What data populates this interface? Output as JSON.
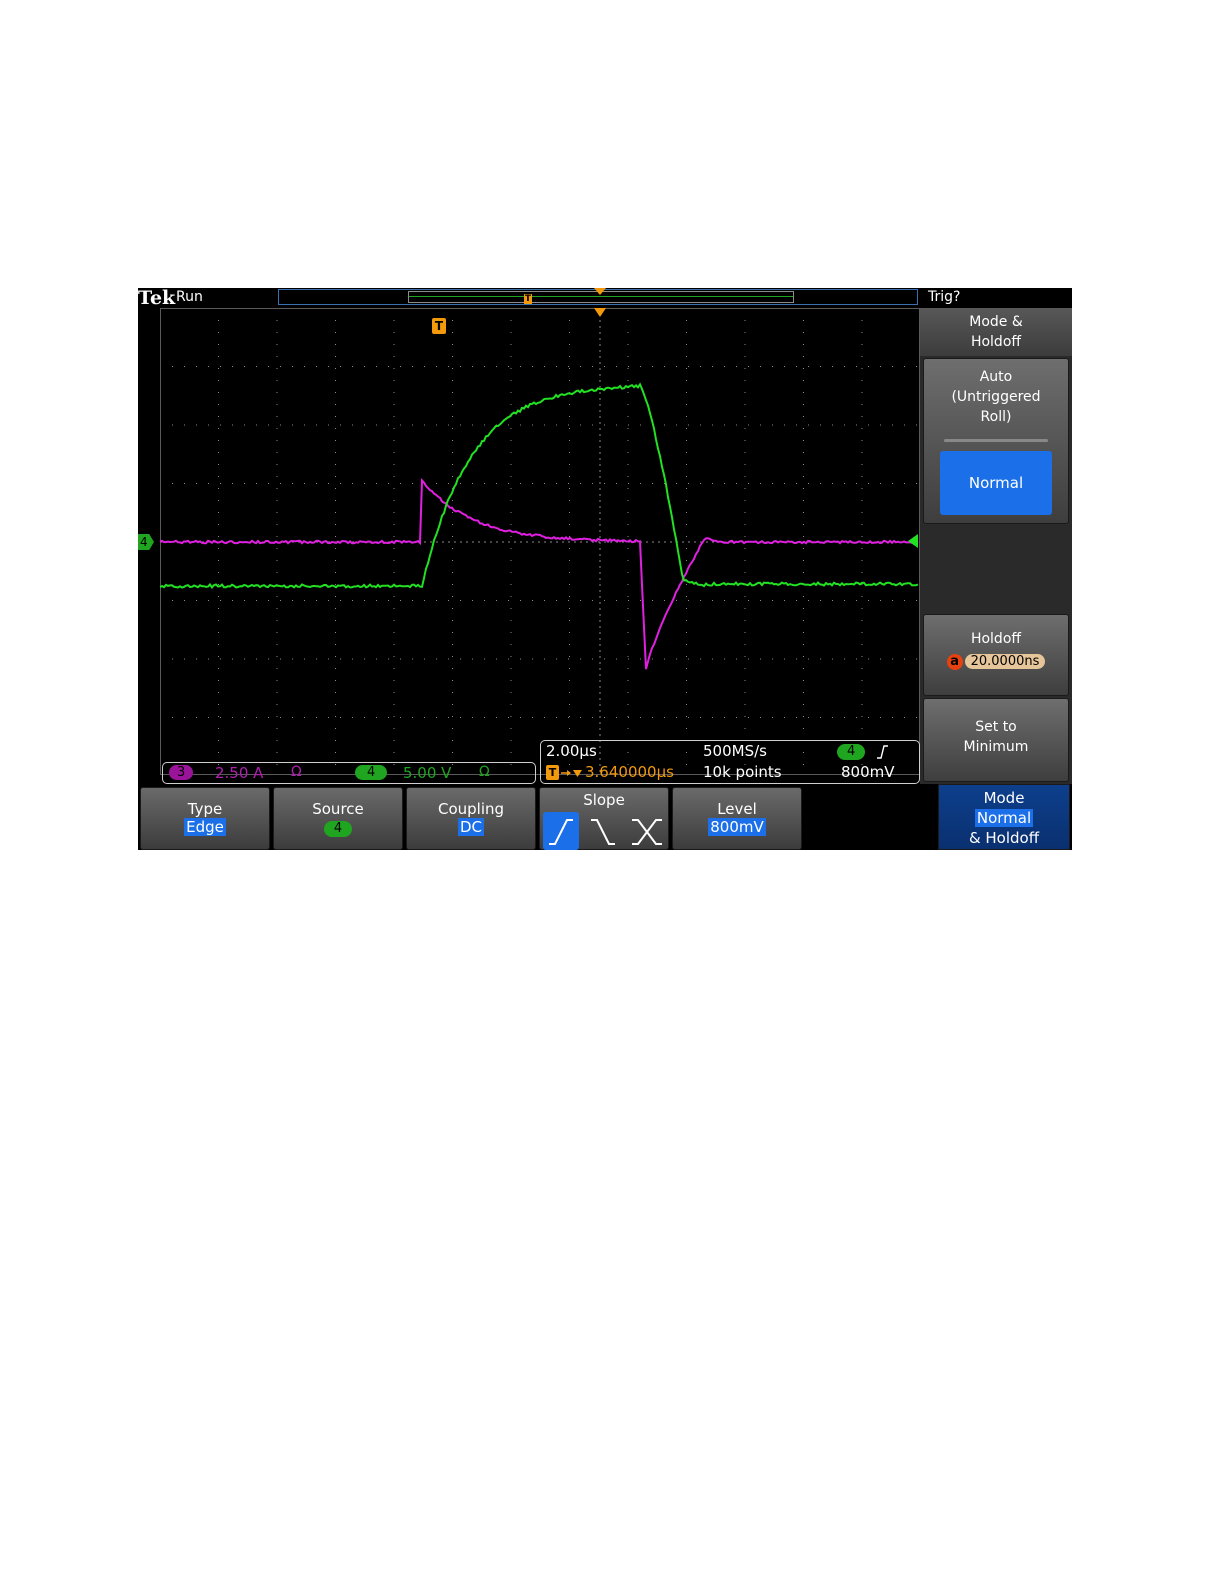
{
  "header": {
    "brand": "Tek",
    "acq_state": "Run",
    "trigger_state": "Trig?"
  },
  "markers": {
    "trigger_marker": "T",
    "channel_ground_marker": "4"
  },
  "side_menu": {
    "title_line1": "Mode &",
    "title_line2": "Holdoff",
    "auto_line1": "Auto",
    "auto_line2": "(Untriggered",
    "auto_line3": "Roll)",
    "normal_label": "Normal",
    "holdoff_label": "Holdoff",
    "holdoff_knob": "a",
    "holdoff_value": "20.0000ns",
    "set_min_line1": "Set to",
    "set_min_line2": "Minimum"
  },
  "channels": [
    {
      "number": "3",
      "scale": "2.50 A",
      "term": "Ω",
      "color": "#c020c0"
    },
    {
      "number": "4",
      "scale": "5.00 V",
      "term": "Ω",
      "color": "#1fa51f"
    }
  ],
  "timebase": {
    "time_per_div": "2.00µs",
    "trigger_offset": "3.640000µs",
    "trigger_offset_icon": "T",
    "sample_rate": "500MS/s",
    "record_length": "10k points",
    "trigger_source": "4",
    "trigger_slope_icon": "rising-edge",
    "trigger_level": "800mV"
  },
  "bottom_menu": {
    "type_label": "Type",
    "type_value": "Edge",
    "source_label": "Source",
    "source_value": "4",
    "coupling_label": "Coupling",
    "coupling_value": "DC",
    "slope_label": "Slope",
    "level_label": "Level",
    "level_value": "800mV",
    "mode_label": "Mode",
    "mode_value": "Normal",
    "mode_suffix": "& Holdoff"
  },
  "colors": {
    "ch3": "#e020e0",
    "ch4": "#22e022",
    "trigger": "#f29a0c",
    "selected": "#1b6fe8"
  }
}
